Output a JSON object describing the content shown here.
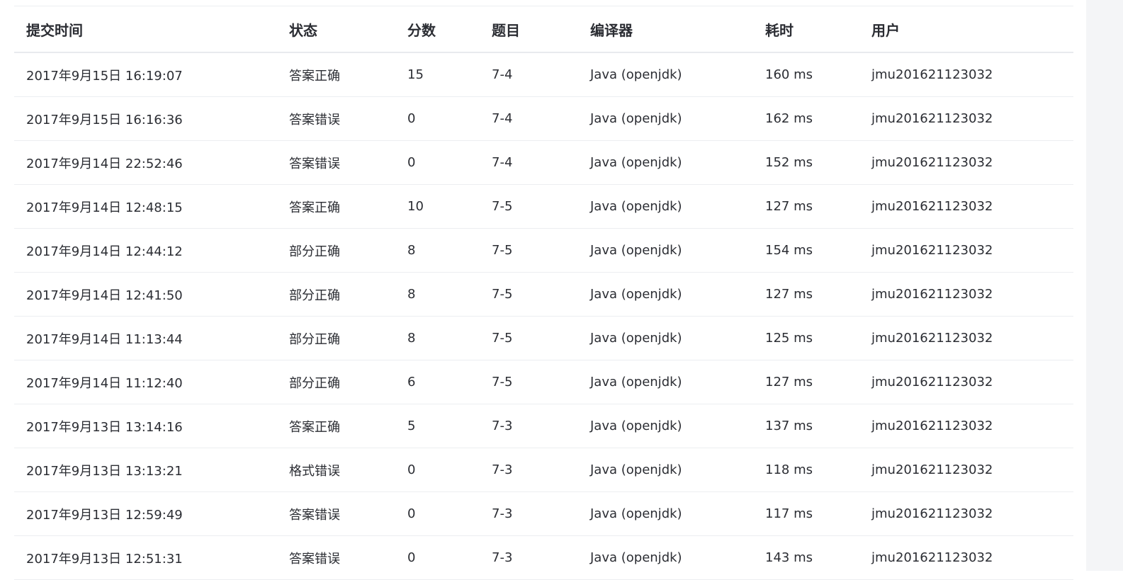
{
  "columns": {
    "submit_time": "提交时间",
    "status": "状态",
    "score": "分数",
    "problem": "题目",
    "compiler": "编译器",
    "time": "耗时",
    "user": "用户"
  },
  "colors": {
    "status_accepted": "#e0463a",
    "status_other": "#3aa655",
    "link": "#1f5fa8"
  },
  "rows": [
    {
      "submit_time": "2017年9月15日 16:19:07",
      "status": "答案正确",
      "status_color": "red",
      "score": "15",
      "problem": "7-4",
      "compiler": "Java (openjdk)",
      "time": "160 ms",
      "user": "jmu201621123032"
    },
    {
      "submit_time": "2017年9月15日 16:16:36",
      "status": "答案错误",
      "status_color": "green",
      "score": "0",
      "problem": "7-4",
      "compiler": "Java (openjdk)",
      "time": "162 ms",
      "user": "jmu201621123032"
    },
    {
      "submit_time": "2017年9月14日 22:52:46",
      "status": "答案错误",
      "status_color": "green",
      "score": "0",
      "problem": "7-4",
      "compiler": "Java (openjdk)",
      "time": "152 ms",
      "user": "jmu201621123032"
    },
    {
      "submit_time": "2017年9月14日 12:48:15",
      "status": "答案正确",
      "status_color": "red",
      "score": "10",
      "problem": "7-5",
      "compiler": "Java (openjdk)",
      "time": "127 ms",
      "user": "jmu201621123032"
    },
    {
      "submit_time": "2017年9月14日 12:44:12",
      "status": "部分正确",
      "status_color": "green",
      "score": "8",
      "problem": "7-5",
      "compiler": "Java (openjdk)",
      "time": "154 ms",
      "user": "jmu201621123032"
    },
    {
      "submit_time": "2017年9月14日 12:41:50",
      "status": "部分正确",
      "status_color": "green",
      "score": "8",
      "problem": "7-5",
      "compiler": "Java (openjdk)",
      "time": "127 ms",
      "user": "jmu201621123032"
    },
    {
      "submit_time": "2017年9月14日 11:13:44",
      "status": "部分正确",
      "status_color": "green",
      "score": "8",
      "problem": "7-5",
      "compiler": "Java (openjdk)",
      "time": "125 ms",
      "user": "jmu201621123032"
    },
    {
      "submit_time": "2017年9月14日 11:12:40",
      "status": "部分正确",
      "status_color": "green",
      "score": "6",
      "problem": "7-5",
      "compiler": "Java (openjdk)",
      "time": "127 ms",
      "user": "jmu201621123032"
    },
    {
      "submit_time": "2017年9月13日 13:14:16",
      "status": "答案正确",
      "status_color": "red",
      "score": "5",
      "problem": "7-3",
      "compiler": "Java (openjdk)",
      "time": "137 ms",
      "user": "jmu201621123032"
    },
    {
      "submit_time": "2017年9月13日 13:13:21",
      "status": "格式错误",
      "status_color": "green",
      "score": "0",
      "problem": "7-3",
      "compiler": "Java (openjdk)",
      "time": "118 ms",
      "user": "jmu201621123032"
    },
    {
      "submit_time": "2017年9月13日 12:59:49",
      "status": "答案错误",
      "status_color": "green",
      "score": "0",
      "problem": "7-3",
      "compiler": "Java (openjdk)",
      "time": "117 ms",
      "user": "jmu201621123032"
    },
    {
      "submit_time": "2017年9月13日 12:51:31",
      "status": "答案错误",
      "status_color": "green",
      "score": "0",
      "problem": "7-3",
      "compiler": "Java (openjdk)",
      "time": "143 ms",
      "user": "jmu201621123032"
    }
  ]
}
